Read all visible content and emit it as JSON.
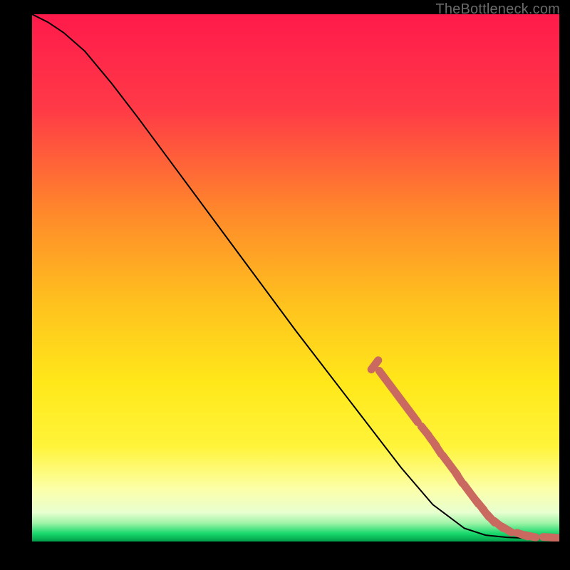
{
  "attribution": "TheBottleneck.com",
  "colors": {
    "bg": "#000000",
    "grad_top": "#ff1a4b",
    "grad_mid_upper": "#ff6e3a",
    "grad_mid": "#ffd21f",
    "grad_mid_lower": "#fff13a",
    "grad_pale": "#fcffc0",
    "grad_green": "#00d860",
    "curve_stroke": "#000000",
    "marker_fill": "#c9695f",
    "attribution_text": "#6b6b6b"
  },
  "chart_data": {
    "type": "line",
    "title": "",
    "xlabel": "",
    "ylabel": "",
    "xlim": [
      0,
      100
    ],
    "ylim": [
      0,
      100
    ],
    "grid": false,
    "legend_position": "none",
    "curve": [
      {
        "x": 0,
        "y": 100
      },
      {
        "x": 3,
        "y": 98.5
      },
      {
        "x": 6,
        "y": 96.5
      },
      {
        "x": 10,
        "y": 93
      },
      {
        "x": 15,
        "y": 87
      },
      {
        "x": 20,
        "y": 80.5
      },
      {
        "x": 30,
        "y": 67
      },
      {
        "x": 40,
        "y": 53.5
      },
      {
        "x": 50,
        "y": 40
      },
      {
        "x": 60,
        "y": 27
      },
      {
        "x": 70,
        "y": 14
      },
      {
        "x": 76,
        "y": 7
      },
      {
        "x": 82,
        "y": 2.5
      },
      {
        "x": 86,
        "y": 1.2
      },
      {
        "x": 90,
        "y": 0.8
      },
      {
        "x": 95,
        "y": 0.6
      },
      {
        "x": 100,
        "y": 0.6
      }
    ],
    "markers": [
      {
        "x": 65,
        "y": 33.5
      },
      {
        "x": 66.5,
        "y": 31.5
      },
      {
        "x": 68,
        "y": 29.5
      },
      {
        "x": 69.5,
        "y": 27.5
      },
      {
        "x": 71,
        "y": 25.5
      },
      {
        "x": 72.5,
        "y": 23.5
      },
      {
        "x": 74.5,
        "y": 21
      },
      {
        "x": 76,
        "y": 19
      },
      {
        "x": 77,
        "y": 17.5
      },
      {
        "x": 78.5,
        "y": 15.5
      },
      {
        "x": 80,
        "y": 13.5
      },
      {
        "x": 81,
        "y": 12
      },
      {
        "x": 82.5,
        "y": 10
      },
      {
        "x": 84,
        "y": 8
      },
      {
        "x": 85,
        "y": 6.8
      },
      {
        "x": 86,
        "y": 5.5
      },
      {
        "x": 87,
        "y": 4.4
      },
      {
        "x": 88.5,
        "y": 3.2
      },
      {
        "x": 90,
        "y": 2.3
      },
      {
        "x": 93,
        "y": 1.3
      },
      {
        "x": 94.5,
        "y": 1.0
      },
      {
        "x": 98,
        "y": 0.8
      },
      {
        "x": 99.5,
        "y": 0.7
      }
    ]
  }
}
